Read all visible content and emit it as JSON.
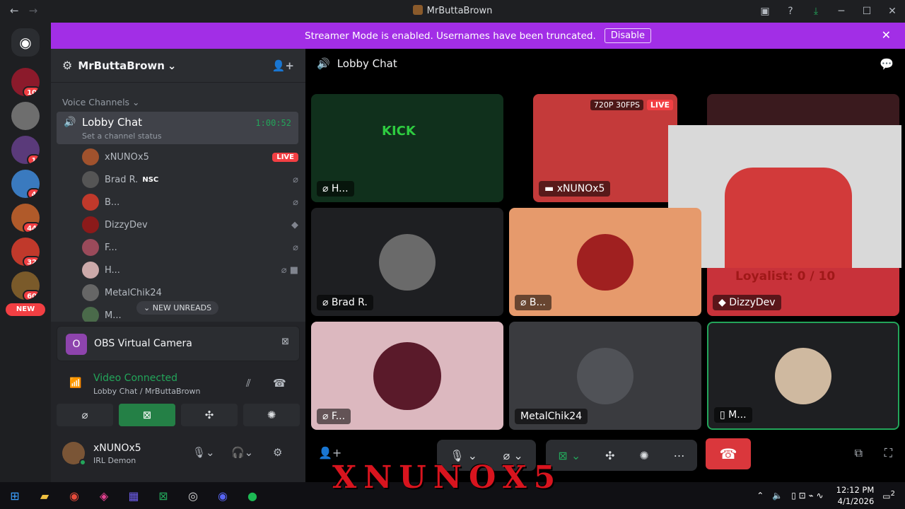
{
  "window": {
    "title": "MrButtaBrown"
  },
  "banner": {
    "text": "Streamer Mode is enabled. Usernames have been truncated.",
    "button": "Disable"
  },
  "rail": {
    "badges": [
      "10",
      "1",
      "4",
      "44",
      "32",
      "60"
    ],
    "new_label": "NEW"
  },
  "server": {
    "name": "MrButtaBrown"
  },
  "sidebar": {
    "category": "Voice Channels",
    "channel": {
      "name": "Lobby Chat",
      "timer": "1:00:52",
      "status": "Set a channel status"
    },
    "users": [
      {
        "name": "xNUNOx5",
        "live": "LIVE"
      },
      {
        "name": "Brad R.",
        "tag": "NSC"
      },
      {
        "name": "B..."
      },
      {
        "name": "DizzyDev"
      },
      {
        "name": "F..."
      },
      {
        "name": "H..."
      },
      {
        "name": "MetalChik24"
      },
      {
        "name": "M..."
      }
    ],
    "new_unreads": "NEW UNREADS"
  },
  "panel": {
    "obs_title": "OBS Virtual Camera",
    "connected": "Video Connected",
    "connected_sub": "Lobby Chat / MrButtaBrown",
    "user_name": "xNUNOx5",
    "user_status": "IRL Demon"
  },
  "main": {
    "channel": "Lobby Chat",
    "stream_quality": "720P 30FPS",
    "live": "LIVE",
    "tiles": [
      "H...",
      "xNUNOx5",
      "Brad R.",
      "B...",
      "DizzyDev",
      "F...",
      "MetalChik24",
      "M..."
    ],
    "overlay_text": "Loyalist: 0 / 10"
  },
  "taskbar": {
    "time": "12:12 PM",
    "date": "4/1/2026",
    "notif": "2"
  },
  "watermark": "XNUNOX5"
}
